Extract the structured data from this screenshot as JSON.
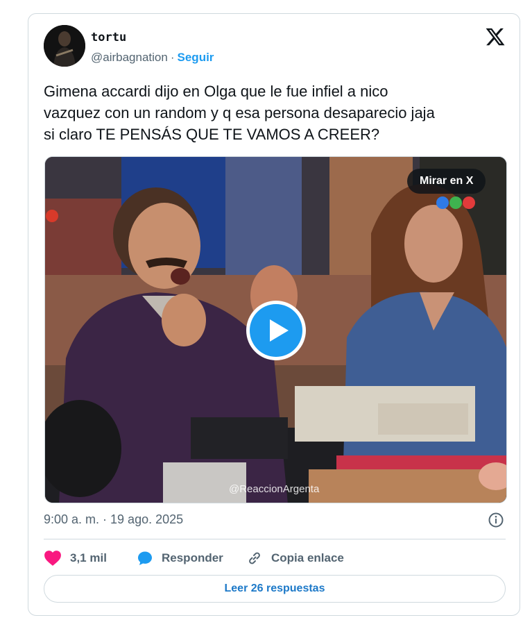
{
  "author": {
    "display_name": "tortu",
    "handle": "@airbagnation",
    "separator": "·",
    "follow_label": "Seguir"
  },
  "tweet": {
    "text": "Gimena accardi dijo en Olga que le fue infiel a nico\nvazquez con un random y q esa persona desaparecio jaja\nsi claro TE PENSÁS QUE TE VAMOS A CREER?"
  },
  "media": {
    "watch_on_x_label": "Mirar en X",
    "watermark": "@ReaccionArgenta",
    "play_icon": "play-icon"
  },
  "meta": {
    "timestamp": "9:00 a. m. · 19 ago. 2025"
  },
  "actions": {
    "likes": "3,1 mil",
    "reply_label": "Responder",
    "copy_link_label": "Copia enlace"
  },
  "footer": {
    "read_replies_label": "Leer 26 respuestas"
  },
  "colors": {
    "accent": "#1d9bf0",
    "like": "#f91880",
    "muted": "#536471"
  }
}
